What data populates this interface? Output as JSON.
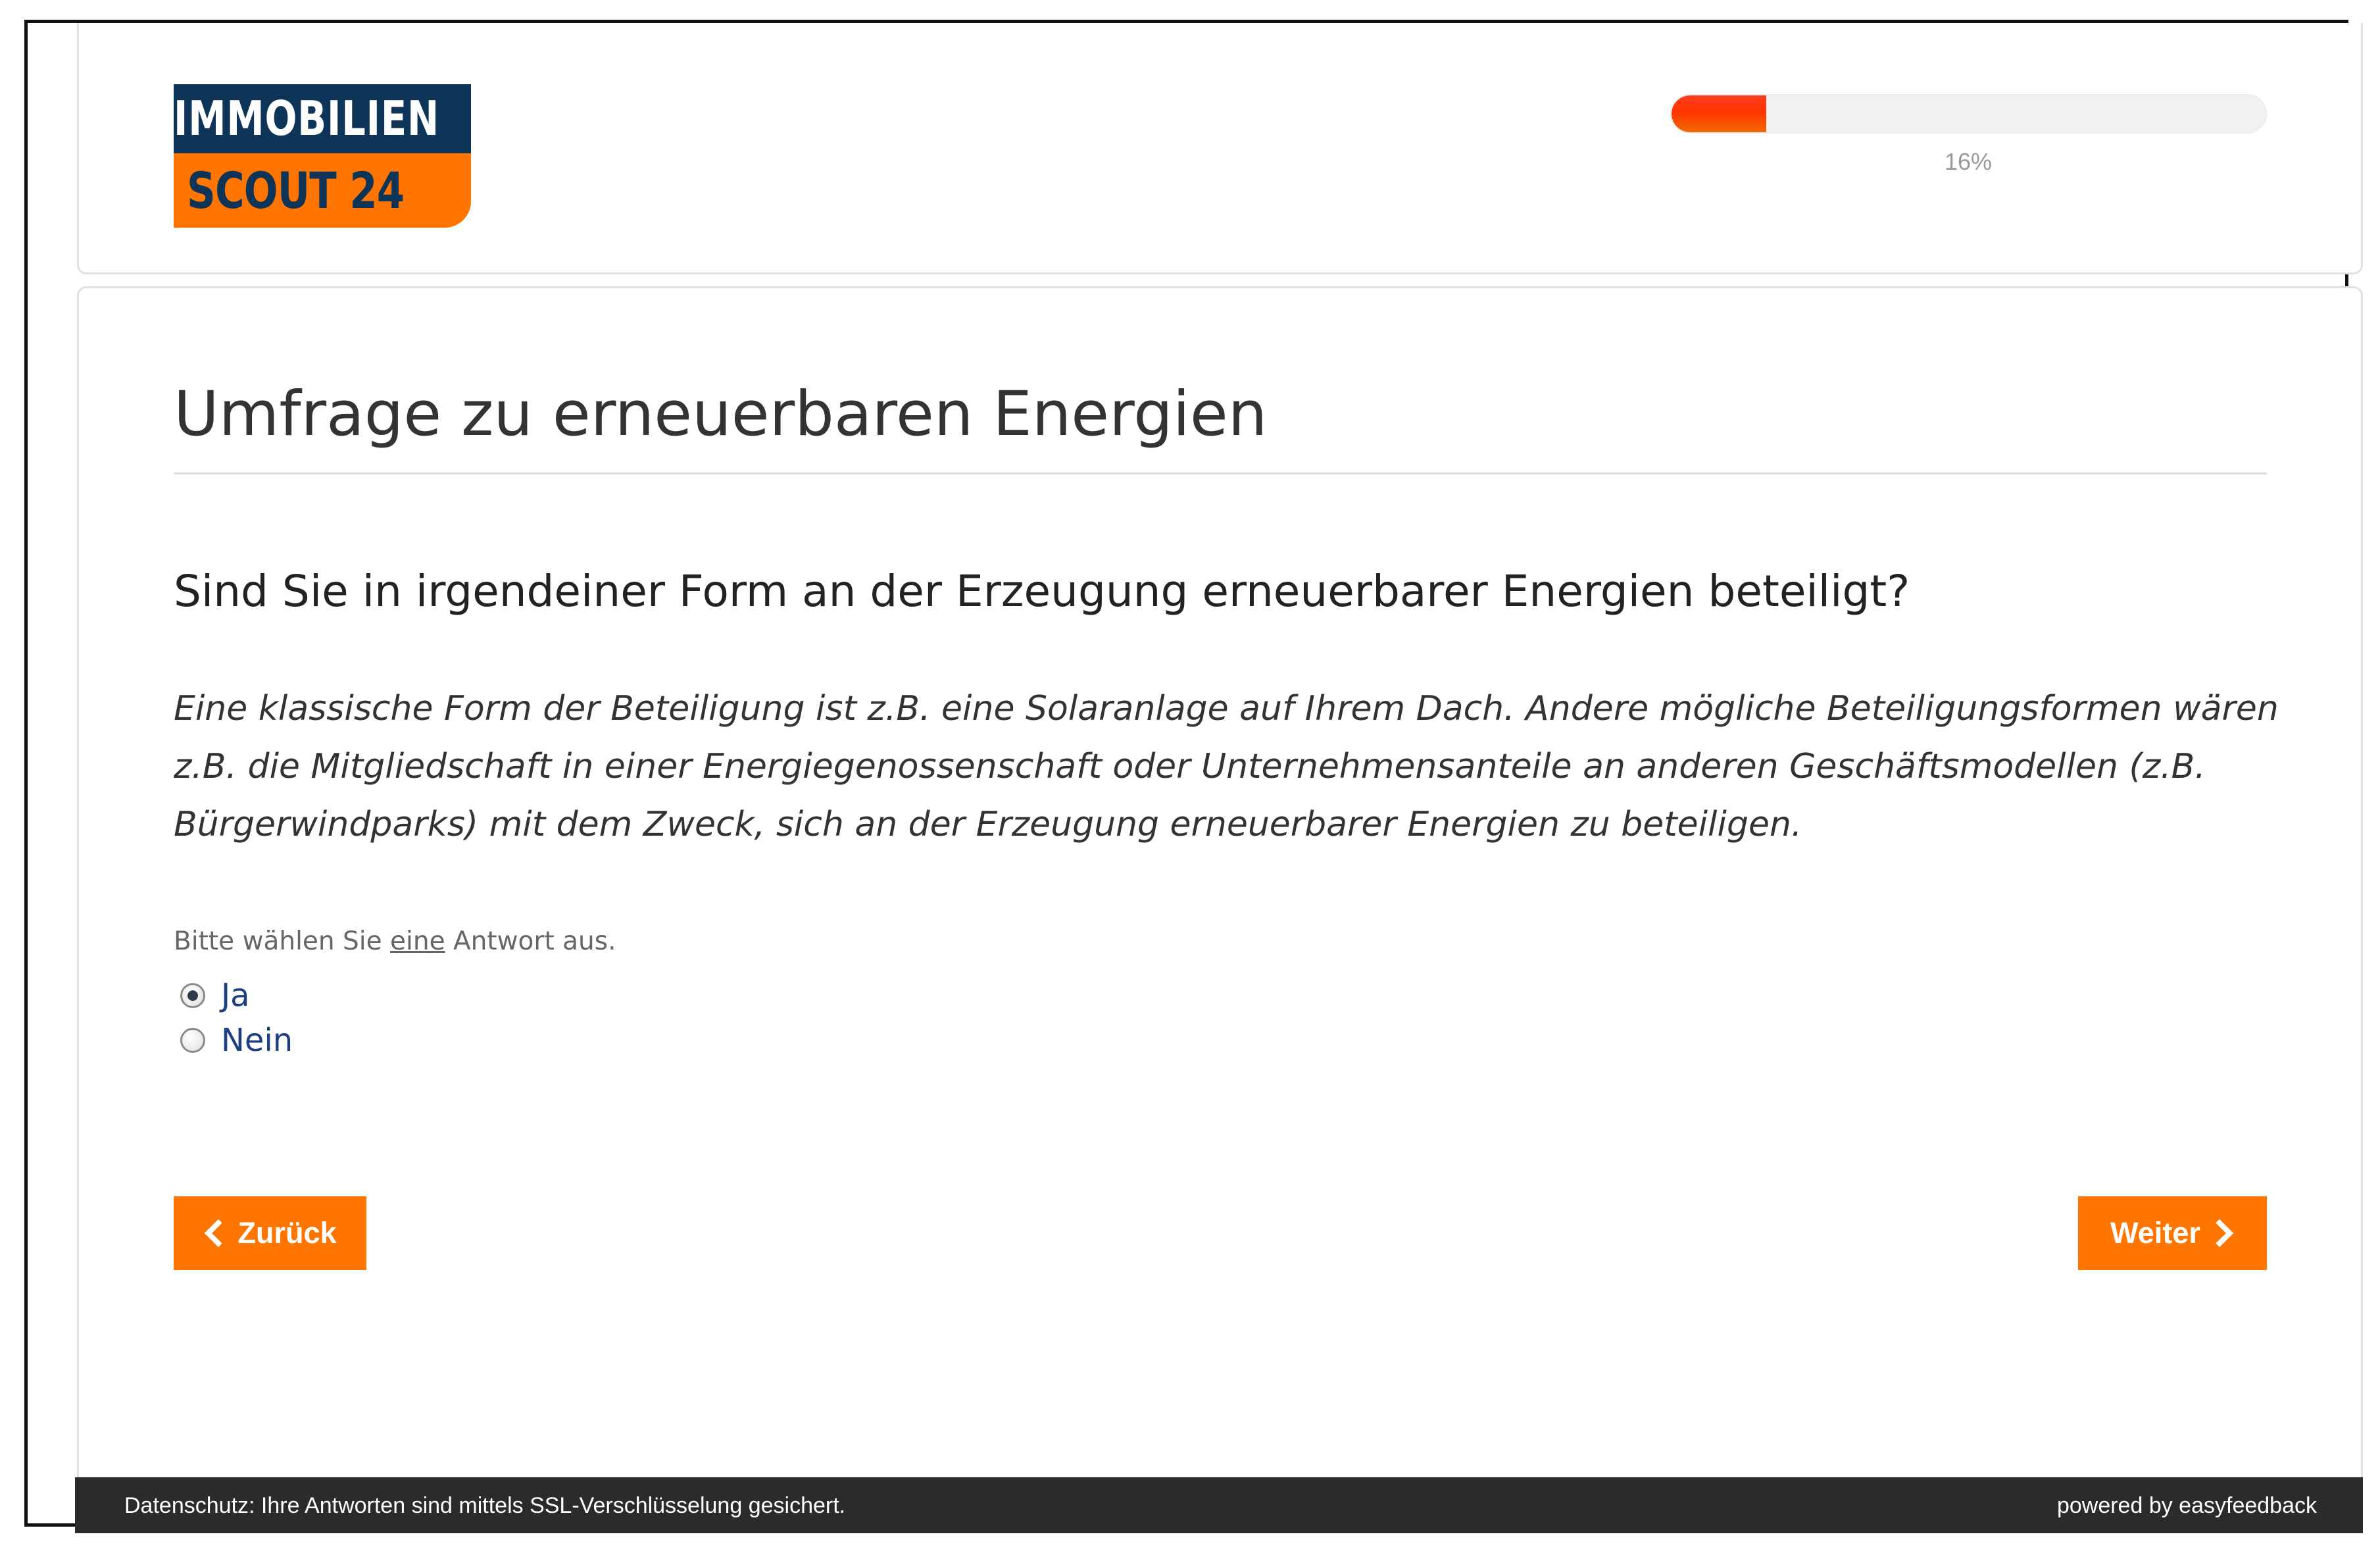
{
  "logo": {
    "line1": "IMMOBILIEN",
    "line2": "SCOUT 24"
  },
  "progress": {
    "value": 0.16,
    "text": "16%"
  },
  "survey": {
    "title": "Umfrage zu erneuerbaren Energien",
    "question": "Sind Sie in irgendeiner Form an der Erzeugung erneuerbarer Energien beteiligt?",
    "explanation_lines": [
      "Eine klassische Form der Beteiligung ist z.B. eine Solaranlage auf Ihrem Dach. Andere mögliche Beteiligungsformen wären",
      "z.B. die Mitgliedschaft in einer Energiegenossenschaft oder Unternehmensanteile an anderen Geschäftsmodellen (z.B.",
      "Bürgerwindparks) mit dem Zweck, sich an der Erzeugung erneuerbarer Energien zu beteiligen."
    ],
    "instruction": {
      "before": "Bitte wählen Sie ",
      "underlined": "eine",
      "after": " Antwort aus."
    },
    "options": [
      {
        "label": "Ja",
        "selected": true
      },
      {
        "label": "Nein",
        "selected": false
      }
    ]
  },
  "buttons": {
    "back": "Zurück",
    "next": "Weiter"
  },
  "footer": {
    "privacy": "Datenschutz: Ihre Antworten sind mittels SSL-Verschlüsselung gesichert.",
    "powered": "powered by easyfeedback"
  },
  "colors": {
    "brand_orange": "#ff7500",
    "brand_navy": "#0e3458",
    "footer_bg": "#2b2b2b"
  },
  "icons": {
    "back": "chevron-left-icon",
    "next": "chevron-right-icon"
  }
}
